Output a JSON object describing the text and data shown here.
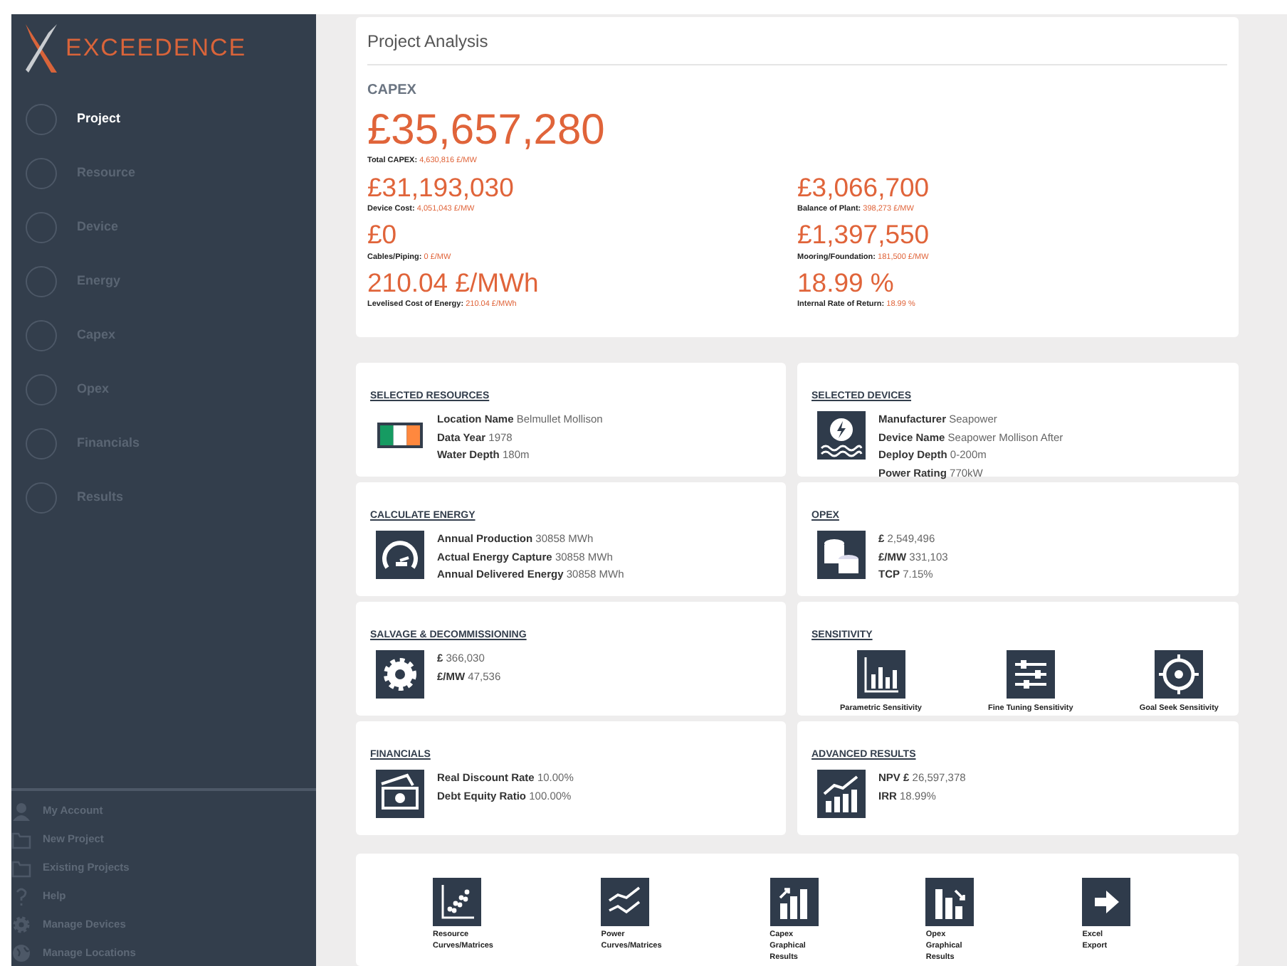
{
  "sidebar": {
    "logo": "EXCEEDENCE",
    "steps": [
      {
        "label": "Project",
        "selected": true
      },
      {
        "label": "Resource",
        "selected": false
      },
      {
        "label": "Device",
        "selected": false
      },
      {
        "label": "Energy",
        "selected": false
      },
      {
        "label": "Capex",
        "selected": false
      },
      {
        "label": "Opex",
        "selected": false
      },
      {
        "label": "Financials",
        "selected": false
      },
      {
        "label": "Results",
        "selected": false
      }
    ],
    "links": [
      {
        "label": "My Account"
      },
      {
        "label": "New Project"
      },
      {
        "label": "Existing Projects"
      },
      {
        "label": "Help"
      },
      {
        "label": "Manage Devices"
      },
      {
        "label": "Manage Locations"
      }
    ]
  },
  "header": {
    "title": "Project Analysis"
  },
  "capex": {
    "heading": "CAPEX",
    "total": {
      "value": "£35,657,280",
      "label": "Total CAPEX:",
      "detail": "4,630,816 £/MW"
    },
    "items": [
      {
        "value": "£31,193,030",
        "label": "Device Cost:",
        "detail": "4,051,043 £/MW"
      },
      {
        "value": "£3,066,700",
        "label": "Balance of Plant:",
        "detail": "398,273 £/MW"
      },
      {
        "value": "£0",
        "label": "Cables/Piping:",
        "detail": "0 £/MW"
      },
      {
        "value": "£1,397,550",
        "label": "Mooring/Foundation:",
        "detail": "181,500 £/MW"
      },
      {
        "value": "210.04 £/MWh",
        "label": "Levelised Cost of Energy:",
        "detail": "210.04 £/MWh"
      },
      {
        "value": "18.99 %",
        "label": "Internal Rate of Return:",
        "detail": "18.99 %"
      }
    ]
  },
  "cards": [
    {
      "title": "SELECTED RESOURCES",
      "kind": "fields",
      "fields": [
        {
          "label": "Location Name",
          "value": "Belmullet Mollison"
        },
        {
          "label": "Data Year",
          "value": "1978"
        },
        {
          "label": "Water Depth",
          "value": "180m"
        }
      ]
    },
    {
      "title": "SELECTED DEVICES",
      "kind": "fields",
      "fields": [
        {
          "label": "Manufacturer",
          "value": "Seapower"
        },
        {
          "label": "Device Name",
          "value": "Seapower Mollison After"
        },
        {
          "label": "Deploy Depth",
          "value": "0-200m"
        },
        {
          "label": "Power Rating",
          "value": "770kW"
        }
      ]
    },
    {
      "title": "CALCULATE ENERGY",
      "kind": "fields",
      "fields": [
        {
          "label": "Annual Production",
          "value": "30858 MWh"
        },
        {
          "label": "Actual Energy Capture",
          "value": "30858 MWh"
        },
        {
          "label": "Annual Delivered Energy",
          "value": "30858 MWh"
        }
      ]
    },
    {
      "title": "OPEX",
      "kind": "fields",
      "fields": [
        {
          "label": "£",
          "value": "2,549,496"
        },
        {
          "label": "£/MW",
          "value": "331,103"
        },
        {
          "label": "TCP",
          "value": "7.15%"
        }
      ]
    },
    {
      "title": "SALVAGE & DECOMMISSIONING",
      "kind": "fields",
      "fields": [
        {
          "label": "£",
          "value": "366,030"
        },
        {
          "label": "£/MW",
          "value": "47,536"
        }
      ]
    },
    {
      "title": "SENSITIVITY",
      "kind": "actions",
      "actions": [
        {
          "label": "Parametric Sensitivity"
        },
        {
          "label": "Fine Tuning Sensitivity"
        },
        {
          "label": "Goal Seek Sensitivity"
        }
      ]
    },
    {
      "title": "FINANCIALS",
      "kind": "fields",
      "fields": [
        {
          "label": "Real Discount Rate",
          "value": "10.00%"
        },
        {
          "label": "Debt Equity Ratio",
          "value": "100.00%"
        }
      ]
    },
    {
      "title": "ADVANCED RESULTS",
      "kind": "fields",
      "fields": [
        {
          "label": "NPV £",
          "value": "26,597,378"
        },
        {
          "label": "IRR",
          "value": "18.99%"
        }
      ]
    }
  ],
  "tools": [
    {
      "label": "Resource Curves/Matrices"
    },
    {
      "label": "Power Curves/Matrices"
    },
    {
      "label": "Capex Graphical Results"
    },
    {
      "label": "Opex Graphical Results"
    },
    {
      "label": "Excel Export"
    }
  ]
}
